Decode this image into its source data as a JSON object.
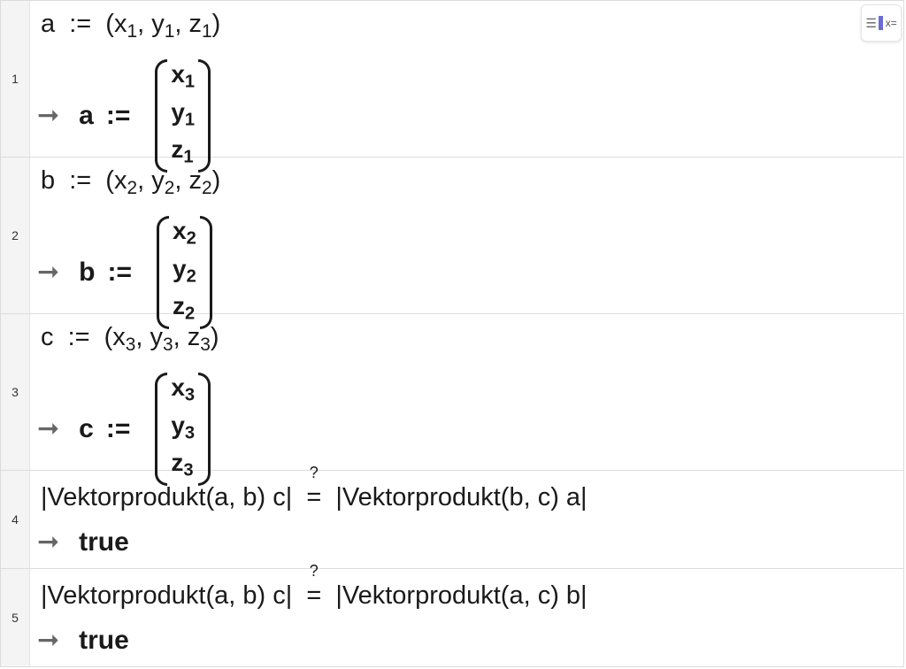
{
  "toolbar": {
    "icon": "keyboard-toggle-icon",
    "label": "x="
  },
  "rows": [
    {
      "number": "1",
      "input": {
        "name": "a",
        "assign": ":=",
        "open": "(",
        "x": "x",
        "xs": "1",
        "y": "y",
        "ys": "1",
        "z": "z",
        "zs": "1",
        "close": ")"
      },
      "output": {
        "arrow": "➞",
        "name": "a",
        "assign": ":=",
        "items": [
          "x",
          "1",
          "y",
          "1",
          "z",
          "1"
        ]
      }
    },
    {
      "number": "2",
      "input": {
        "name": "b",
        "assign": ":=",
        "open": "(",
        "x": "x",
        "xs": "2",
        "y": "y",
        "ys": "2",
        "z": "z",
        "zs": "2",
        "close": ")"
      },
      "output": {
        "arrow": "➞",
        "name": "b",
        "assign": ":=",
        "items": [
          "x",
          "2",
          "y",
          "2",
          "z",
          "2"
        ]
      }
    },
    {
      "number": "3",
      "input": {
        "name": "c",
        "assign": ":=",
        "open": "(",
        "x": "x",
        "xs": "3",
        "y": "y",
        "ys": "3",
        "z": "z",
        "zs": "3",
        "close": ")"
      },
      "output": {
        "arrow": "➞",
        "name": "c",
        "assign": ":=",
        "items": [
          "x",
          "3",
          "y",
          "3",
          "z",
          "3"
        ]
      }
    },
    {
      "number": "4",
      "input": {
        "left": "|Vektorprodukt(a, b) c|",
        "op": "=",
        "q": "?",
        "right": "|Vektorprodukt(b, c) a|"
      },
      "output": {
        "arrow": "➞",
        "value": "true"
      }
    },
    {
      "number": "5",
      "input": {
        "left": "|Vektorprodukt(a, b) c|",
        "op": "=",
        "q": "?",
        "right": "|Vektorprodukt(a, c) b|"
      },
      "output": {
        "arrow": "➞",
        "value": "true"
      }
    }
  ]
}
